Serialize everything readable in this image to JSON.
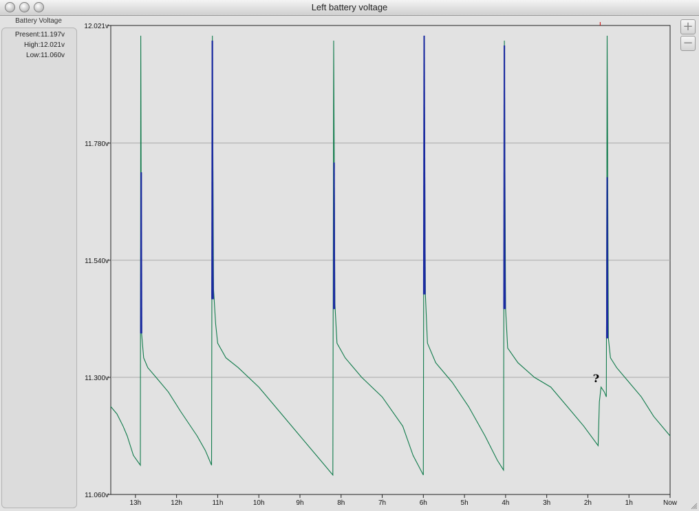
{
  "window": {
    "title": "Left battery voltage"
  },
  "sidebar": {
    "tab_label": "Battery Voltage",
    "present_label": "Present:",
    "present_value": "11.197v",
    "high_label": "High:",
    "high_value": "12.021v",
    "low_label": "Low:",
    "low_value": "11.060v"
  },
  "icons": {
    "zoom_in": "plus-icon",
    "zoom_out": "minus-icon",
    "resize": "resize-grip-icon"
  },
  "colors": {
    "charging_line": "#1a2aa0",
    "discharging_line": "#0f7a4a",
    "marker": "#cc0000",
    "grid": "#a8a8a8"
  },
  "chart_data": {
    "type": "line",
    "x_unit": "hours before now",
    "xlim": [
      13.6,
      0
    ],
    "ylim": [
      11.06,
      12.021
    ],
    "y_ticks": [
      {
        "label": "12.021v",
        "value": 12.021
      },
      {
        "label": "11.780v",
        "value": 11.78
      },
      {
        "label": "11.540v",
        "value": 11.54
      },
      {
        "label": "11.300v",
        "value": 11.3
      },
      {
        "label": "11.060v",
        "value": 11.06
      }
    ],
    "x_ticks": [
      {
        "label": "13h",
        "value": 13
      },
      {
        "label": "12h",
        "value": 12
      },
      {
        "label": "11h",
        "value": 11
      },
      {
        "label": "10h",
        "value": 10
      },
      {
        "label": "9h",
        "value": 9
      },
      {
        "label": "8h",
        "value": 8
      },
      {
        "label": "7h",
        "value": 7
      },
      {
        "label": "6h",
        "value": 6
      },
      {
        "label": "5h",
        "value": 5
      },
      {
        "label": "4h",
        "value": 4
      },
      {
        "label": "3h",
        "value": 3
      },
      {
        "label": "2h",
        "value": 2
      },
      {
        "label": "1h",
        "value": 1
      },
      {
        "label": "Now",
        "value": 0
      }
    ],
    "grid": true,
    "annotation": {
      "text": "?",
      "x": 1.8,
      "y": 11.29
    },
    "marker_x": 1.7,
    "series": [
      {
        "role": "discharging",
        "color": "#0f7a4a",
        "points": [
          [
            13.6,
            11.24
          ],
          [
            13.45,
            11.225
          ],
          [
            13.3,
            11.2
          ],
          [
            13.2,
            11.18
          ],
          [
            13.05,
            11.14
          ],
          [
            12.88,
            11.12
          ],
          [
            12.87,
            12.0
          ],
          [
            12.85,
            11.39
          ],
          [
            12.8,
            11.34
          ],
          [
            12.7,
            11.32
          ],
          [
            12.5,
            11.3
          ],
          [
            12.2,
            11.27
          ],
          [
            11.9,
            11.23
          ],
          [
            11.5,
            11.18
          ],
          [
            11.3,
            11.15
          ],
          [
            11.15,
            11.12
          ],
          [
            11.13,
            12.0
          ],
          [
            11.1,
            11.48
          ],
          [
            11.05,
            11.41
          ],
          [
            11.0,
            11.37
          ],
          [
            10.8,
            11.34
          ],
          [
            10.5,
            11.32
          ],
          [
            10.0,
            11.28
          ],
          [
            9.5,
            11.23
          ],
          [
            9.0,
            11.18
          ],
          [
            8.5,
            11.13
          ],
          [
            8.2,
            11.1
          ],
          [
            8.18,
            11.99
          ],
          [
            8.15,
            11.45
          ],
          [
            8.1,
            11.37
          ],
          [
            7.9,
            11.34
          ],
          [
            7.5,
            11.3
          ],
          [
            7.0,
            11.26
          ],
          [
            6.5,
            11.2
          ],
          [
            6.25,
            11.14
          ],
          [
            6.0,
            11.1
          ],
          [
            5.98,
            11.99
          ],
          [
            5.95,
            11.47
          ],
          [
            5.9,
            11.37
          ],
          [
            5.7,
            11.33
          ],
          [
            5.3,
            11.29
          ],
          [
            4.9,
            11.24
          ],
          [
            4.5,
            11.18
          ],
          [
            4.2,
            11.13
          ],
          [
            4.05,
            11.11
          ],
          [
            4.03,
            11.99
          ],
          [
            4.0,
            11.44
          ],
          [
            3.95,
            11.36
          ],
          [
            3.7,
            11.33
          ],
          [
            3.3,
            11.3
          ],
          [
            2.9,
            11.28
          ],
          [
            2.5,
            11.24
          ],
          [
            2.1,
            11.2
          ],
          [
            1.75,
            11.16
          ],
          [
            1.72,
            11.25
          ],
          [
            1.68,
            11.28
          ],
          [
            1.6,
            11.27
          ],
          [
            1.55,
            11.26
          ],
          [
            1.53,
            12.0
          ],
          [
            1.5,
            11.38
          ],
          [
            1.45,
            11.34
          ],
          [
            1.3,
            11.32
          ],
          [
            1.0,
            11.29
          ],
          [
            0.7,
            11.26
          ],
          [
            0.4,
            11.22
          ],
          [
            0.1,
            11.19
          ],
          [
            0.0,
            11.18
          ]
        ]
      },
      {
        "role": "charging",
        "color": "#1a2aa0",
        "points": [
          [
            12.87,
            11.39
          ],
          [
            12.86,
            11.72
          ],
          [
            12.85,
            11.39
          ],
          [
            11.14,
            11.46
          ],
          [
            11.13,
            11.99
          ],
          [
            11.12,
            11.55
          ],
          [
            11.11,
            11.46
          ],
          [
            8.18,
            11.44
          ],
          [
            8.17,
            11.74
          ],
          [
            8.16,
            11.44
          ],
          [
            5.99,
            11.47
          ],
          [
            5.98,
            12.0
          ],
          [
            5.97,
            11.72
          ],
          [
            5.96,
            11.47
          ],
          [
            4.04,
            11.44
          ],
          [
            4.03,
            11.98
          ],
          [
            4.02,
            11.54
          ],
          [
            4.01,
            11.44
          ],
          [
            1.54,
            11.38
          ],
          [
            1.53,
            11.71
          ],
          [
            1.52,
            11.38
          ]
        ]
      }
    ]
  }
}
